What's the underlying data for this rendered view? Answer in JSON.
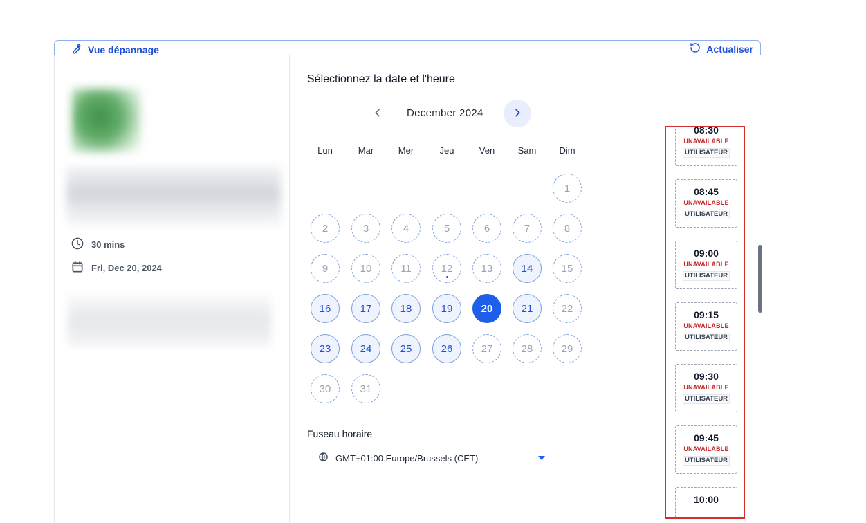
{
  "toolbar": {
    "troubleshoot_label": "Vue dépannage",
    "refresh_label": "Actualiser"
  },
  "event": {
    "duration": "30 mins",
    "date": "Fri, Dec 20, 2024"
  },
  "picker": {
    "title": "Sélectionnez la date et l'heure",
    "month_label": "December 2024",
    "weekdays": [
      "Lun",
      "Mar",
      "Mer",
      "Jeu",
      "Ven",
      "Sam",
      "Dim"
    ],
    "days": [
      "1",
      "2",
      "3",
      "4",
      "5",
      "6",
      "7",
      "8",
      "9",
      "10",
      "11",
      "12",
      "13",
      "14",
      "15",
      "16",
      "17",
      "18",
      "19",
      "20",
      "21",
      "22",
      "23",
      "24",
      "25",
      "26",
      "27",
      "28",
      "29",
      "30",
      "31"
    ]
  },
  "timezone": {
    "label": "Fuseau horaire",
    "value": "GMT+01:00 Europe/Brussels (CET)"
  },
  "slots": [
    {
      "time": "08:30",
      "status": "UNAVAILABLE",
      "tag": "UTILISATEUR"
    },
    {
      "time": "08:45",
      "status": "UNAVAILABLE",
      "tag": "UTILISATEUR"
    },
    {
      "time": "09:00",
      "status": "UNAVAILABLE",
      "tag": "UTILISATEUR"
    },
    {
      "time": "09:15",
      "status": "UNAVAILABLE",
      "tag": "UTILISATEUR"
    },
    {
      "time": "09:30",
      "status": "UNAVAILABLE",
      "tag": "UTILISATEUR"
    },
    {
      "time": "09:45",
      "status": "UNAVAILABLE",
      "tag": "UTILISATEUR"
    },
    {
      "time": "10:00",
      "status": "",
      "tag": ""
    }
  ],
  "colors": {
    "accent": "#1d5fe8",
    "link": "#1d4fd8",
    "unavailable": "#c62828",
    "highlight_frame": "#d32f2f"
  }
}
